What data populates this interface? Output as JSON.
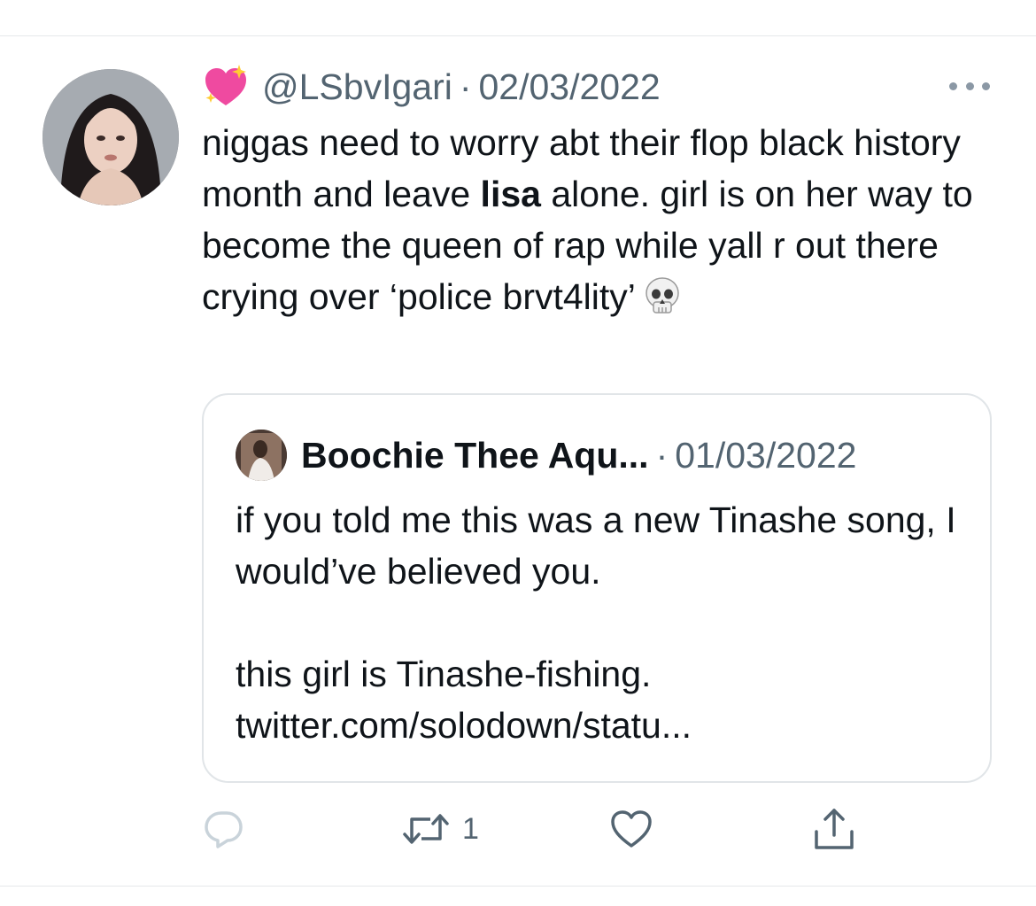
{
  "tweet": {
    "badge_icon": "sparkling-heart-icon",
    "handle": "@LSbvIgari",
    "separator": "·",
    "date": "02/03/2022",
    "text_part1": "niggas need to worry abt their flop black history month and leave ",
    "text_bold": "lisa",
    "text_part2": " alone. girl is on her way to become the queen of rap while yall r out there crying over ‘police brvt4lity’",
    "trailing_emoji": "skull-icon"
  },
  "quote": {
    "name": "Boochie Thee Aqu...",
    "separator": "·",
    "date": "01/03/2022",
    "text": "if you told me this was a new Tinashe song, I would’ve believed you.\n\nthis girl is Tinashe-fishing.\ntwitter.com/solodown/statu..."
  },
  "actions": {
    "reply_icon": "reply-icon",
    "retweet_icon": "retweet-icon",
    "retweet_count": "1",
    "like_icon": "heart-icon",
    "share_icon": "share-icon"
  },
  "colors": {
    "text": "#0f1419",
    "secondary": "#536471",
    "border": "#e1e5e8"
  }
}
